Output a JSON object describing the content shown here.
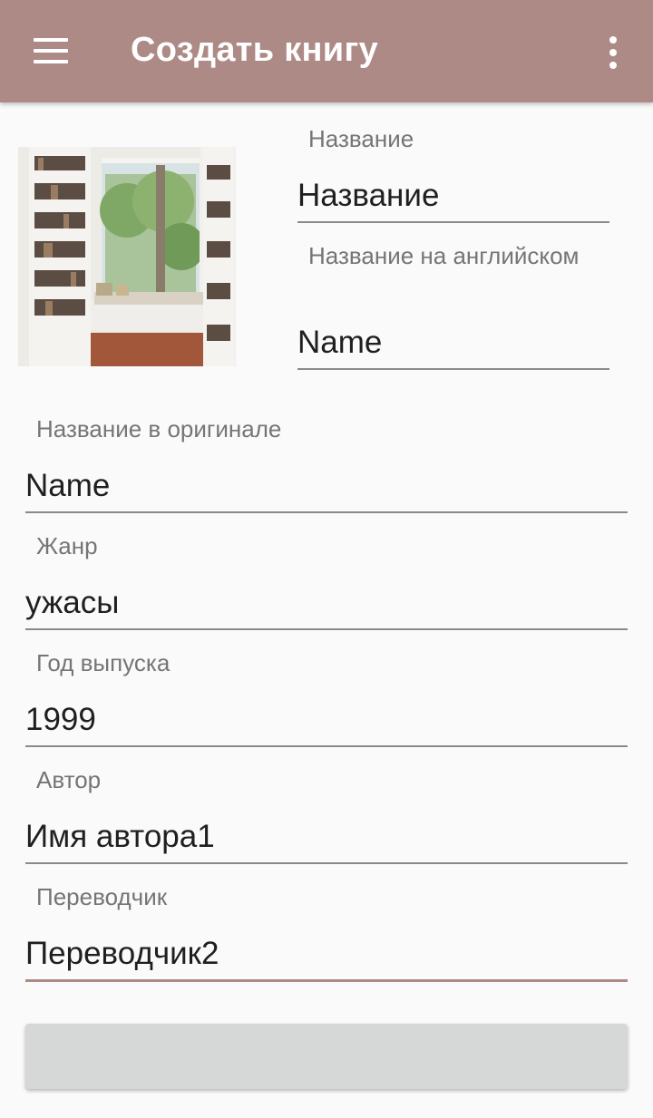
{
  "appbar": {
    "title": "Создать книгу",
    "menu_icon": "hamburger-menu-icon",
    "more_icon": "more-vert-icon",
    "color": "#ad8a86"
  },
  "cover_image": {
    "description_icon": "book-cover-image"
  },
  "form": {
    "title_label": "Название",
    "title_value": "Название",
    "english_title_label": "Название на английском",
    "english_title_value": "Name",
    "original_title_label": "Название в оригинале",
    "original_title_value": "Name",
    "genre_label": "Жанр",
    "genre_value": "ужасы",
    "year_label": "Год выпуска",
    "year_value": "1999",
    "author_label": "Автор",
    "author_value": "Имя автора1",
    "translator_label": "Переводчик",
    "translator_value": "Переводчик2"
  },
  "colors": {
    "accent": "#ad8a86",
    "background": "#fafafa",
    "button": "#d6d7d7"
  }
}
